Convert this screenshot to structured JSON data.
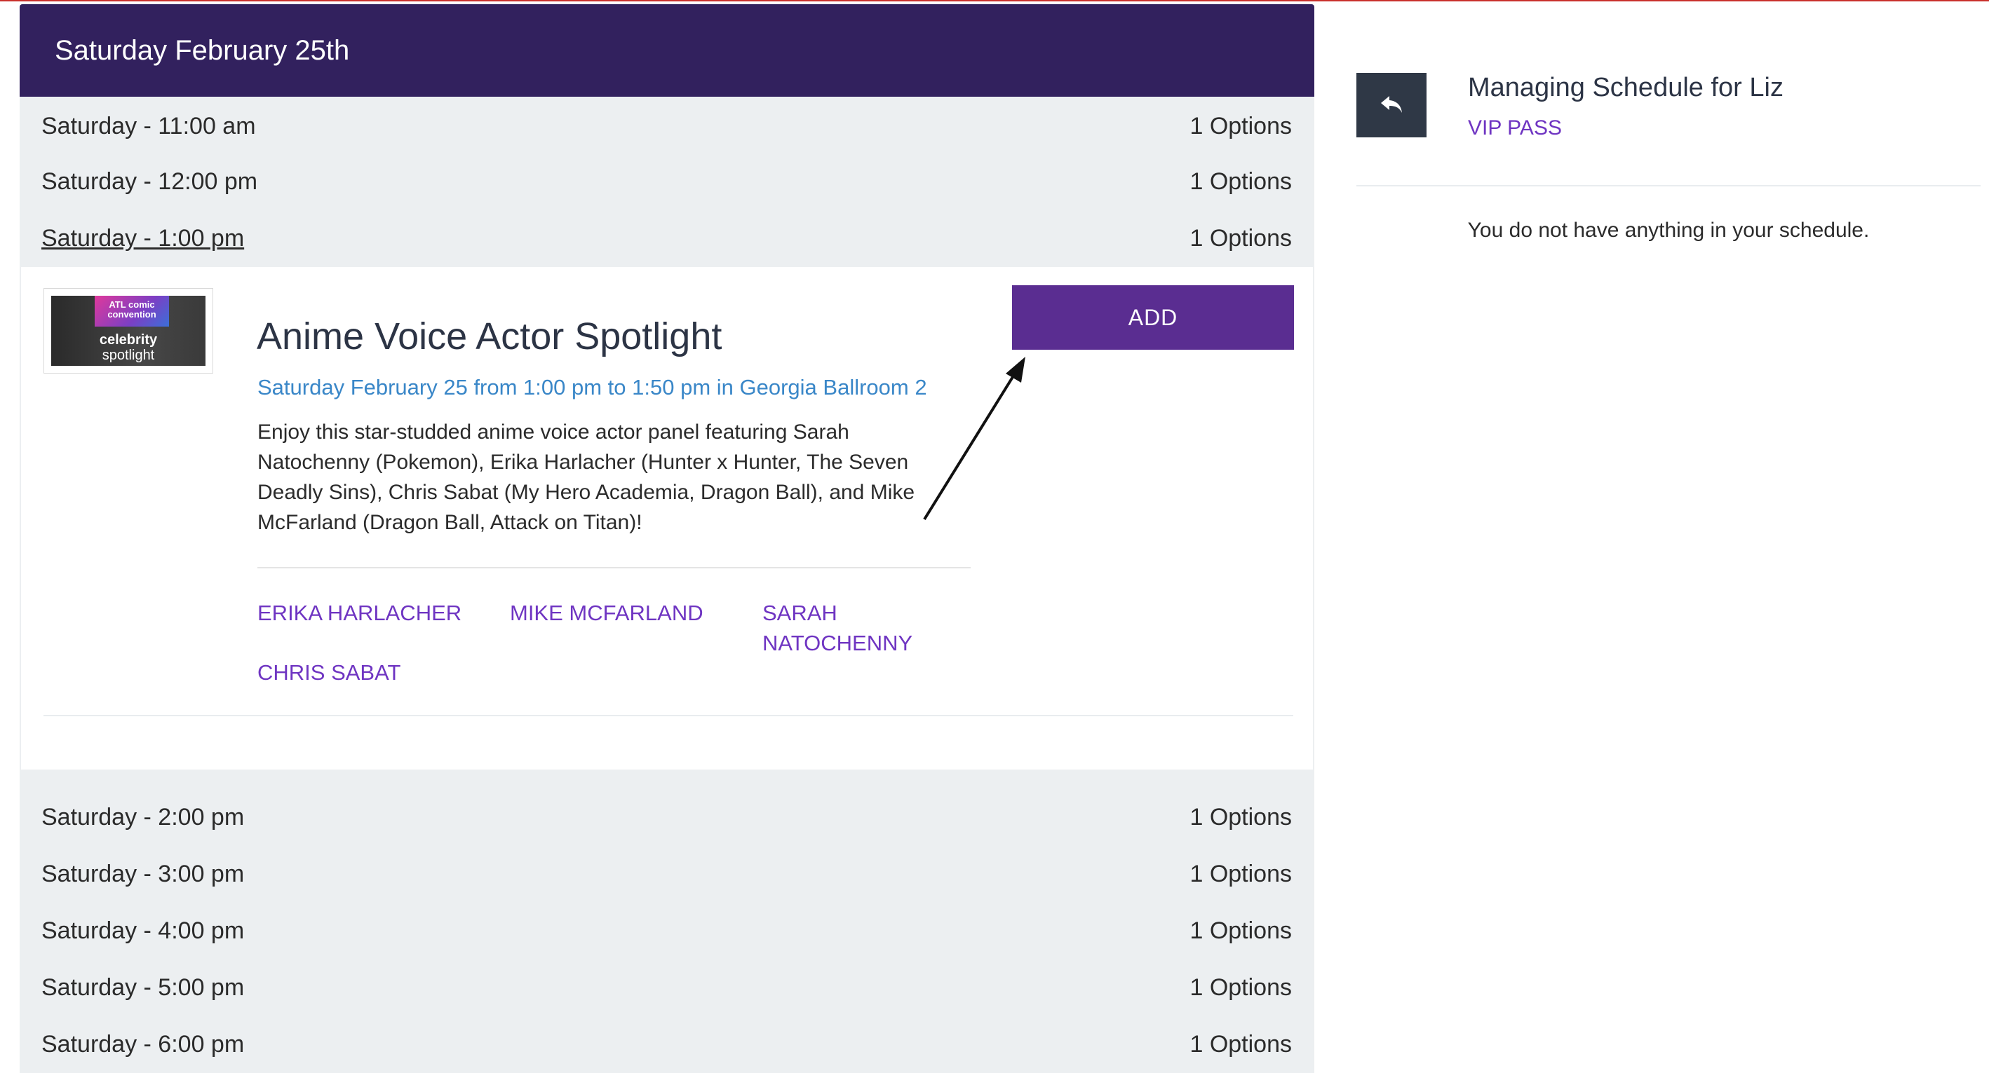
{
  "day_header": "Saturday February 25th",
  "slots_before": [
    {
      "time": "Saturday - 11:00 am",
      "options": "1 Options"
    },
    {
      "time": "Saturday - 12:00 pm",
      "options": "1 Options"
    },
    {
      "time": "Saturday - 1:00 pm",
      "options": "1 Options"
    }
  ],
  "event": {
    "thumb_logo": "ATL comic convention",
    "thumb_line1": "celebrity",
    "thumb_line2": "spotlight",
    "title": "Anime Voice Actor Spotlight",
    "when": "Saturday February 25 from 1:00 pm to 1:50 pm in Georgia Ballroom 2",
    "description": "Enjoy this star-studded anime voice actor panel featuring Sarah Natochenny (Pokemon), Erika Harlacher (Hunter x Hunter, The Seven Deadly Sins), Chris Sabat (My Hero Academia, Dragon Ball), and Mike McFarland (Dragon Ball, Attack on Titan)!",
    "people": [
      "ERIKA HARLACHER",
      "MIKE MCFARLAND",
      "SARAH NATOCHENNY",
      "CHRIS SABAT"
    ],
    "add_label": "ADD"
  },
  "slots_after": [
    {
      "time": "Saturday - 2:00 pm",
      "options": "1 Options"
    },
    {
      "time": "Saturday - 3:00 pm",
      "options": "1 Options"
    },
    {
      "time": "Saturday - 4:00 pm",
      "options": "1 Options"
    },
    {
      "time": "Saturday - 5:00 pm",
      "options": "1 Options"
    },
    {
      "time": "Saturday - 6:00 pm",
      "options": "1 Options"
    }
  ],
  "panel": {
    "title": "Managing Schedule for Liz",
    "pass": "VIP PASS",
    "empty": "You do not have anything in your schedule.",
    "back_icon": "reply-arrow-icon"
  },
  "colors": {
    "header_bg": "#32215e",
    "accent": "#5a2d91",
    "link": "#6f35c2",
    "info": "#3a87c8"
  }
}
